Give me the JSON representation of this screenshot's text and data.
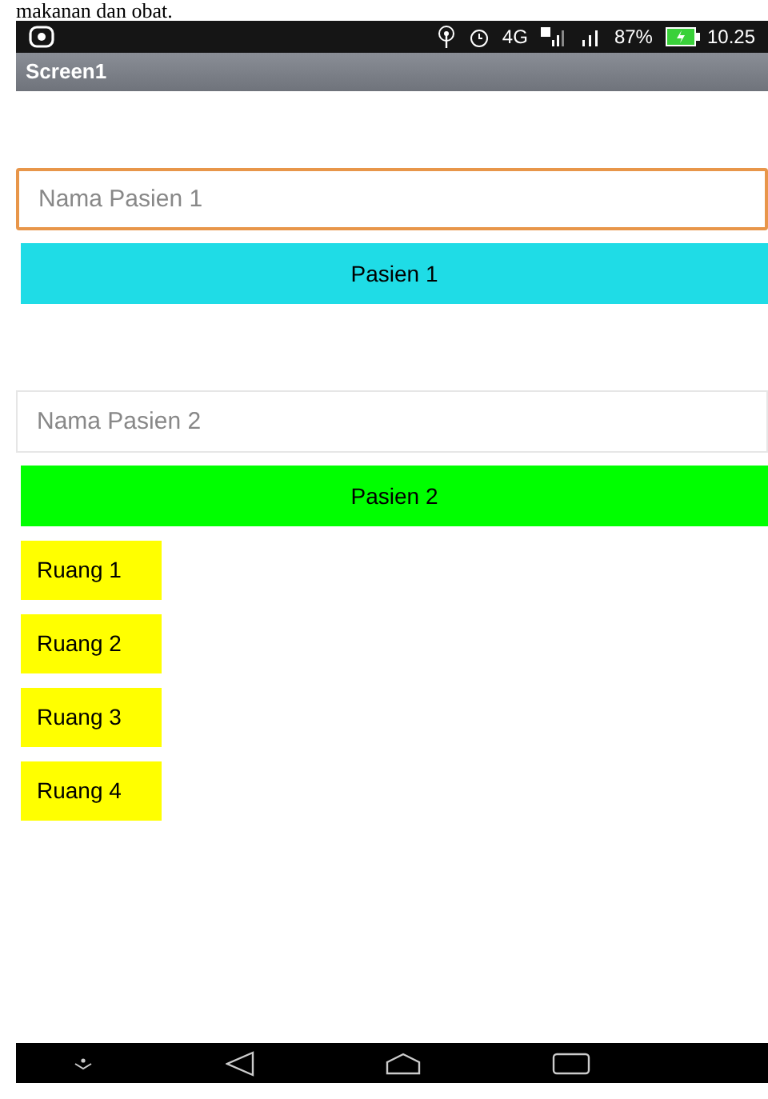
{
  "document_text": "makanan dan obat.",
  "status_bar": {
    "network": "4G",
    "battery": "87%",
    "time": "10.25"
  },
  "app_bar": {
    "title": "Screen1"
  },
  "items": [
    {
      "kind": "field",
      "placeholder": "Nama Pasien 1",
      "focused": true
    },
    {
      "kind": "wide_button",
      "label": "Pasien 1",
      "color": "#1fdce6"
    },
    {
      "kind": "spacer"
    },
    {
      "kind": "field",
      "placeholder": "Nama Pasien 2",
      "focused": false
    },
    {
      "kind": "wide_button",
      "label": "Pasien 2",
      "color": "#00ff00"
    },
    {
      "kind": "small_button",
      "label": "Ruang 1",
      "color": "#ffff00"
    },
    {
      "kind": "small_button",
      "label": "Ruang 2",
      "color": "#ffff00"
    },
    {
      "kind": "small_button",
      "label": "Ruang 3",
      "color": "#ffff00"
    },
    {
      "kind": "small_button",
      "label": "Ruang 4",
      "color": "#ffff00"
    }
  ]
}
